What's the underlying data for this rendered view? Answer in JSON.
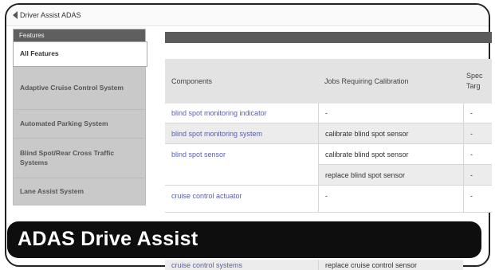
{
  "window": {
    "back_label": "Driver Assist ADAS"
  },
  "sidebar": {
    "header": "Features",
    "items": [
      {
        "label": "All Features"
      },
      {
        "label": "Adaptive Cruise Control System"
      },
      {
        "label": "Automated Parking System"
      },
      {
        "label": "Blind Spot/Rear Cross Traffic Systems"
      },
      {
        "label": "Lane Assist System"
      }
    ]
  },
  "table": {
    "headers": [
      "Components",
      "Jobs Requiring Calibration",
      "Spec",
      "Targ"
    ],
    "rows": [
      {
        "component": "blind spot monitoring indicator",
        "jobs": [
          "-"
        ],
        "spec": [
          "-"
        ]
      },
      {
        "component": "blind spot monitoring system",
        "jobs": [
          "calibrate blind spot sensor"
        ],
        "spec": [
          "-"
        ]
      },
      {
        "component": "blind spot sensor",
        "jobs": [
          "calibrate blind spot sensor",
          "replace blind spot sensor"
        ],
        "spec": [
          "-",
          "-"
        ]
      },
      {
        "component": "cruise control actuator",
        "jobs": [
          "-"
        ],
        "spec": [
          "-"
        ]
      },
      {
        "component": "cruise control systems",
        "jobs": [
          "replace cruise control sensor"
        ],
        "spec": [
          ""
        ]
      }
    ]
  },
  "banner": {
    "title": "ADAS Drive Assist"
  }
}
